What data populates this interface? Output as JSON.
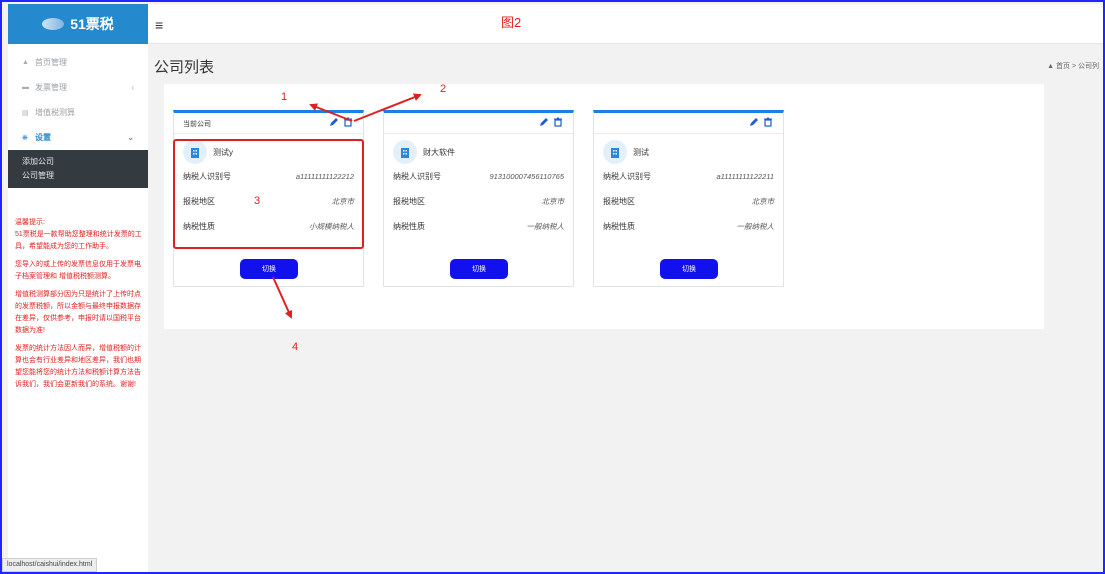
{
  "app": {
    "logo_text": "51票税",
    "figure_label": "图2"
  },
  "sidebar": {
    "items": [
      {
        "icon": "home-icon",
        "label": "首页管理"
      },
      {
        "icon": "folder-icon",
        "label": "发票管理"
      },
      {
        "icon": "chart-icon",
        "label": "增值税测算"
      },
      {
        "icon": "gear-icon",
        "label": "设置"
      }
    ],
    "submenu": [
      "添加公司",
      "公司管理"
    ],
    "tips": [
      "温馨提示:",
      "51票税是一款帮助您整理和统计发票的工具，希望能成为您的工作助手。",
      "您导入的或上传的发票信息仅用于发票电子档案管理和 增值税税额测算。",
      "增值税测算部分因为只是统计了上传时点的发票税额，所以金额与最终申报数据存在差异，仅供参考，申报时请以国税平台数据为准!",
      "发票的统计方法因人而异，增值税额的计算也会有行业差异和地区差异，我们也期望您能将您的统计方法和税额计算方法告诉我们，我们会更新我们的系统。谢谢!"
    ]
  },
  "status_bar": "localhost/caishui/index.html",
  "page": {
    "title": "公司列表",
    "breadcrumb_home": "首页",
    "breadcrumb_sep": ">",
    "breadcrumb_current": "公司列"
  },
  "labels": {
    "tax_id": "纳税人识别号",
    "region": "报税地区",
    "nature": "纳税性质",
    "switch": "切换"
  },
  "cards": [
    {
      "header": "当前公司",
      "name": "测试y",
      "tax_id": "a11111111122212",
      "region": "北京市",
      "nature": "小规模纳税人"
    },
    {
      "header": "",
      "name": "财大软件",
      "tax_id": "913100007456110765",
      "region": "北京市",
      "nature": "一般纳税人"
    },
    {
      "header": "",
      "name": "测试",
      "tax_id": "a11111111122211",
      "region": "北京市",
      "nature": "一般纳税人"
    }
  ],
  "annotations": [
    "1",
    "2",
    "3",
    "4"
  ],
  "colors": {
    "accent": "#2589ce",
    "card_top": "#1a7fe6",
    "button": "#1111ee",
    "annotation": "#e02020",
    "frame": "#1f27ff"
  }
}
